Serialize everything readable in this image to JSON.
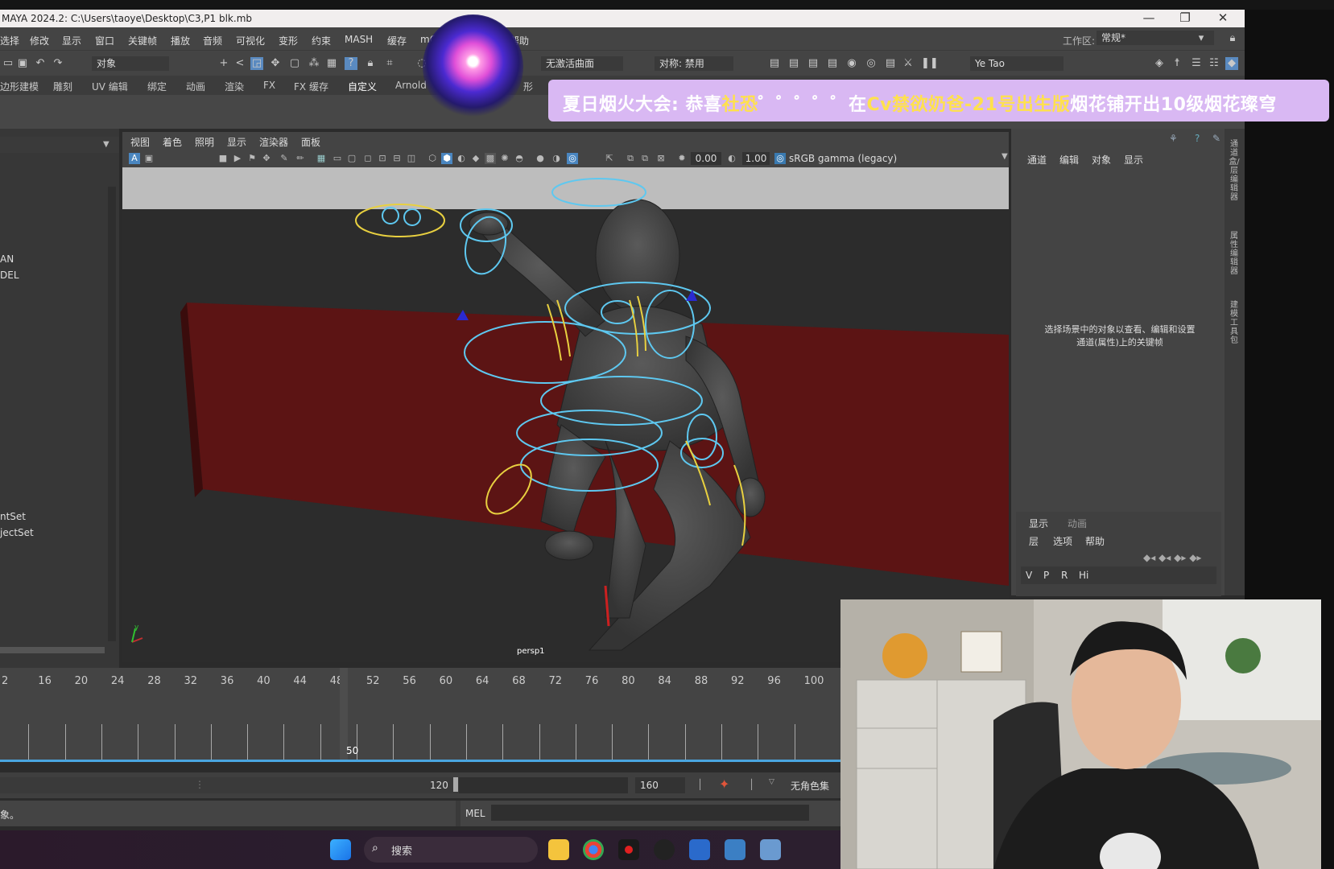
{
  "window": {
    "title": "MAYA 2024.2: C:\\Users\\taoye\\Desktop\\C3,P1 blk.mb",
    "controls": [
      "—",
      "❐",
      "✕"
    ]
  },
  "menubar": {
    "items": [
      "选择",
      "修改",
      "显示",
      "窗口",
      "关键帧",
      "播放",
      "音频",
      "可视化",
      "变形",
      "约束",
      "MASH",
      "缓存",
      "mG",
      "帮助"
    ],
    "workspace_label": "工作区:",
    "workspace_value": "常规*"
  },
  "toolbar": {
    "select_mode": "对象",
    "live_surface": "无激活曲面",
    "symmetry": "对称: 禁用",
    "user": "Ye Tao"
  },
  "shelf": {
    "tabs": [
      "边形建模",
      "雕刻",
      "UV 编辑",
      "绑定",
      "动画",
      "渲染",
      "FX",
      "FX 缓存",
      "自定义",
      "Arnold",
      "形"
    ],
    "active": "自定义"
  },
  "banner": {
    "part1": "夏日烟火大会:",
    "part2": "恭喜",
    "highlight1": "社恐",
    "part3": "゜゜゜゜゜在",
    "highlight2": "Cv禁欲奶爸-21号出生版",
    "part4": "烟花铺开出10级烟花璨穹"
  },
  "outliner": {
    "items": [
      "AN",
      "DEL",
      "ntSet",
      "jectSet"
    ]
  },
  "viewport": {
    "menu": [
      "视图",
      "着色",
      "照明",
      "显示",
      "渲染器",
      "面板"
    ],
    "exposure": "0.00",
    "gamma": "1.00",
    "color_space": "sRGB gamma (legacy)",
    "camera": "persp1",
    "axis_y": "y"
  },
  "channel_box": {
    "tabs": [
      "通道",
      "编辑",
      "对象",
      "显示"
    ],
    "hint": "选择场景中的对象以查看、编辑和设置通道(属性)上的关键帧"
  },
  "side_tabs": [
    "通道盒/层编辑器",
    "属性编辑器",
    "建模工具包"
  ],
  "layer_editor": {
    "tabs": [
      "显示",
      "动画"
    ],
    "menu": [
      "层",
      "选项",
      "帮助"
    ],
    "columns": [
      "V",
      "P",
      "R",
      "Hi"
    ]
  },
  "timeline": {
    "ticks": [
      "2",
      "16",
      "20",
      "24",
      "28",
      "32",
      "36",
      "40",
      "44",
      "48",
      "52",
      "56",
      "60",
      "64",
      "68",
      "72",
      "76",
      "80",
      "84",
      "88",
      "92",
      "96",
      "100"
    ],
    "current_frame": "50"
  },
  "range": {
    "end": "120",
    "anim_end": "160",
    "char_set": "无角色集"
  },
  "command": {
    "lang": "MEL",
    "status": "象。"
  },
  "taskbar": {
    "search": "搜索"
  },
  "colors": {
    "accent": "#4aa6e0",
    "rig_cyan": "#5ec8f0",
    "rig_yellow": "#e8d040",
    "banner_bg": "#d9b8f3",
    "banner_highlight": "#ffe14d"
  }
}
